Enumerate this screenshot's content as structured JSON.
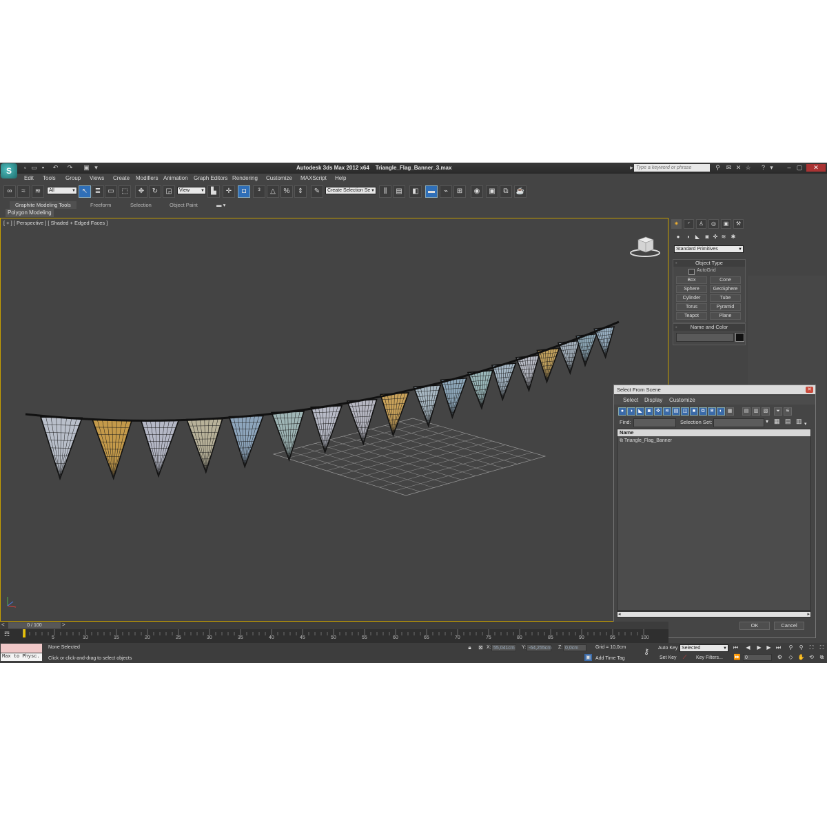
{
  "window": {
    "app_title": "Autodesk 3ds Max  2012 x64",
    "file_name": "Triangle_Flag_Banner_3.max",
    "search_placeholder": "Type a keyword or phrase"
  },
  "menu": [
    "Edit",
    "Tools",
    "Group",
    "Views",
    "Create",
    "Modifiers",
    "Animation",
    "Graph Editors",
    "Rendering",
    "Customize",
    "MAXScript",
    "Help"
  ],
  "toolbar": {
    "selection_filter": "All",
    "ref_coord": "View",
    "named_selection": "Create Selection Se"
  },
  "ribbon": {
    "tabs": [
      "Graphite Modeling Tools",
      "Freeform",
      "Selection",
      "Object Paint"
    ],
    "panel": "Polygon Modeling"
  },
  "viewport": {
    "label": "[ + ] [ Perspective ] [ Shaded + Edged Faces ]",
    "flag_colors": [
      "#b9bfca",
      "#c49a4a",
      "#b5b8c6",
      "#b8b29a",
      "#8ea6bd",
      "#9fb6b6",
      "#b9bcc8",
      "#b6b7c2",
      "#c9a25a",
      "#a9b9c4",
      "#8fa9bc",
      "#9ab8ba",
      "#a6b8c6",
      "#b9bcc6",
      "#c4a35e",
      "#a7b4c0",
      "#8ea9b8",
      "#9bb3c6"
    ]
  },
  "command_panel": {
    "dropdown": "Standard Primitives",
    "object_type_title": "Object Type",
    "autogrid": "AutoGrid",
    "buttons": [
      "Box",
      "Cone",
      "Sphere",
      "GeoSphere",
      "Cylinder",
      "Tube",
      "Torus",
      "Pyramid",
      "Teapot",
      "Plane"
    ],
    "name_color_title": "Name and Color"
  },
  "dialog": {
    "title": "Select From Scene",
    "menu": [
      "Select",
      "Display",
      "Customize"
    ],
    "find_label": "Find:",
    "selection_set_label": "Selection Set:",
    "column_name": "Name",
    "rows": [
      "Triangle_Flag_Banner"
    ],
    "ok": "OK",
    "cancel": "Cancel"
  },
  "timeline": {
    "frame_display": "0 / 100",
    "ticks": [
      "0",
      "5",
      "10",
      "15",
      "20",
      "25",
      "30",
      "35",
      "40",
      "45",
      "50",
      "55",
      "60",
      "65",
      "70",
      "75",
      "80",
      "85",
      "90",
      "95",
      "100"
    ]
  },
  "status": {
    "maxscript": "Max to Physc.",
    "selection": "None Selected",
    "prompt": "Click or click-and-drag to select objects",
    "x_label": "X:",
    "x_value": "55,041cm",
    "y_label": "Y:",
    "y_value": "-64,255cm",
    "z_label": "Z:",
    "z_value": "0,0cm",
    "grid": "Grid = 10,0cm",
    "add_time_tag": "Add Time Tag",
    "auto_key": "Auto Key",
    "auto_key_mode": "Selected",
    "set_key": "Set Key",
    "key_filters": "Key Filters...",
    "current_frame": "0"
  }
}
